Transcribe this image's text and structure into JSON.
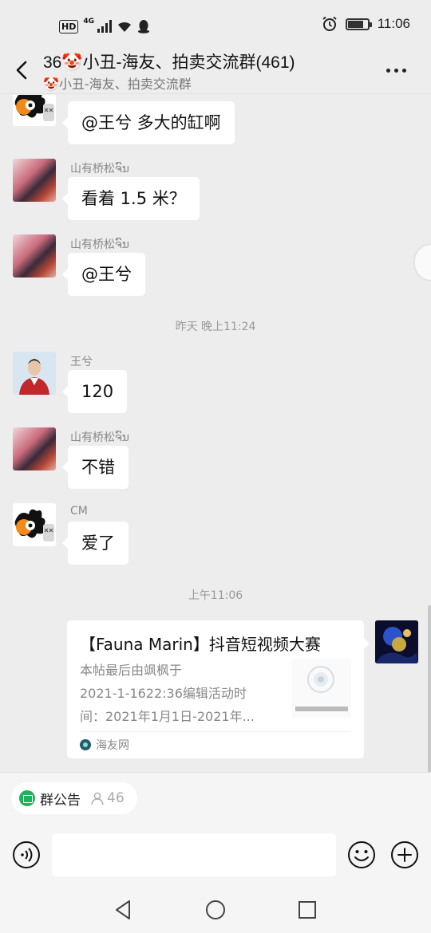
{
  "status_bar": {
    "hd": "HD",
    "network": "4G",
    "time": "11:06",
    "battery_level": 0.8
  },
  "header": {
    "title": "36🤡小丑-海友、拍卖交流群(461)",
    "subtitle": "🤡小丑-海友、拍卖交流群"
  },
  "messages": [
    {
      "sender": "CM",
      "text": "@王兮  多大的缸啊",
      "avatar": "cm-avatar"
    },
    {
      "sender": "山有桥松ຈົນ",
      "text": "看着 1.5 米？",
      "avatar": "shanyou-avatar"
    },
    {
      "sender": "山有桥松ຈົນ",
      "text": "@王兮",
      "avatar": "shanyou-avatar"
    },
    {
      "sender": "王兮",
      "text": "120",
      "avatar": "wangxi-avatar"
    },
    {
      "sender": "山有桥松ຈົນ",
      "text": "不错",
      "avatar": "shanyou-avatar"
    },
    {
      "sender": "CM",
      "text": "爱了",
      "avatar": "cm-avatar"
    }
  ],
  "timestamps": [
    "昨天 晚上11:24",
    "上午11:06"
  ],
  "link_card": {
    "title": "【Fauna Marin】抖音短视频大赛",
    "desc_lines": [
      "本帖最后由飒枫于",
      "2021-1-1622:36编辑活动时",
      "间：2021年1月1日-2021年..."
    ],
    "source": "海友网"
  },
  "bottom": {
    "notice_label": "群公告",
    "member_count": "46",
    "input_value": "",
    "input_placeholder": ""
  },
  "colors": {
    "background": "#ededed",
    "bubble": "#ffffff",
    "notice_green": "#21b05c"
  }
}
